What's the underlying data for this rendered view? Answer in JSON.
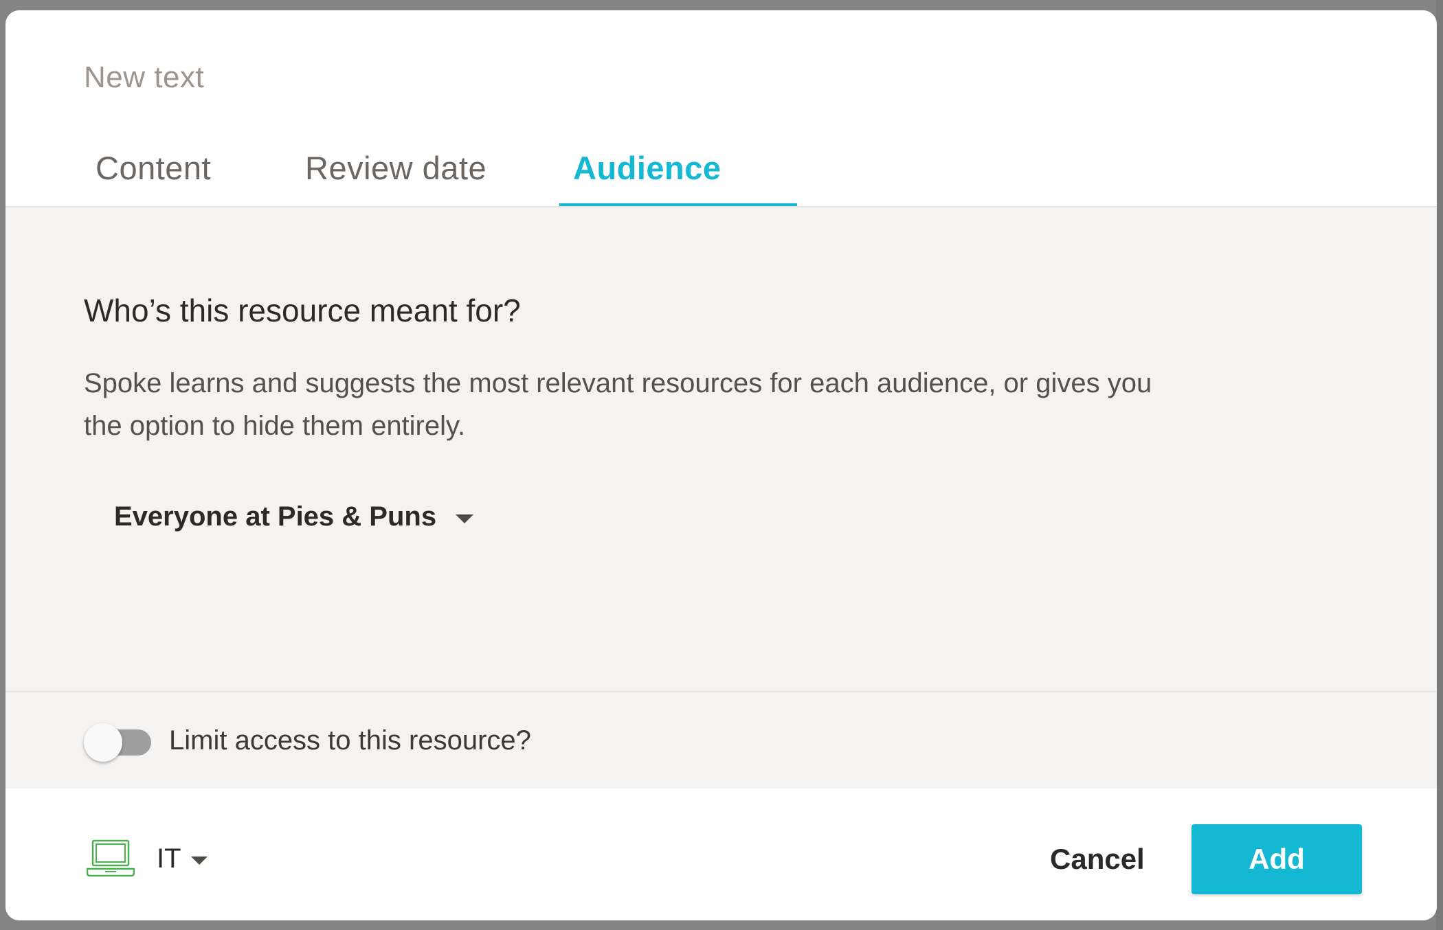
{
  "modal": {
    "title": "New text"
  },
  "tabs": [
    {
      "label": "Content",
      "active": false
    },
    {
      "label": "Review date",
      "active": false
    },
    {
      "label": "Audience",
      "active": true
    }
  ],
  "audience": {
    "heading": "Who’s this resource meant for?",
    "description": "Spoke learns and suggests the most relevant resources for each audience, or gives you the option to hide them entirely.",
    "selected": "Everyone at Pies & Puns",
    "dropdown_icon": "caret-down-icon"
  },
  "limit_access": {
    "label": "Limit access to this resource?",
    "enabled": false
  },
  "footer": {
    "team_icon": "laptop-icon",
    "team": "IT",
    "cancel_label": "Cancel",
    "add_label": "Add"
  },
  "colors": {
    "accent": "#14b8d3",
    "icon_green": "#4caf50",
    "panel_bg": "#f4f3f1",
    "toggle_off": "#9e9e9e"
  }
}
